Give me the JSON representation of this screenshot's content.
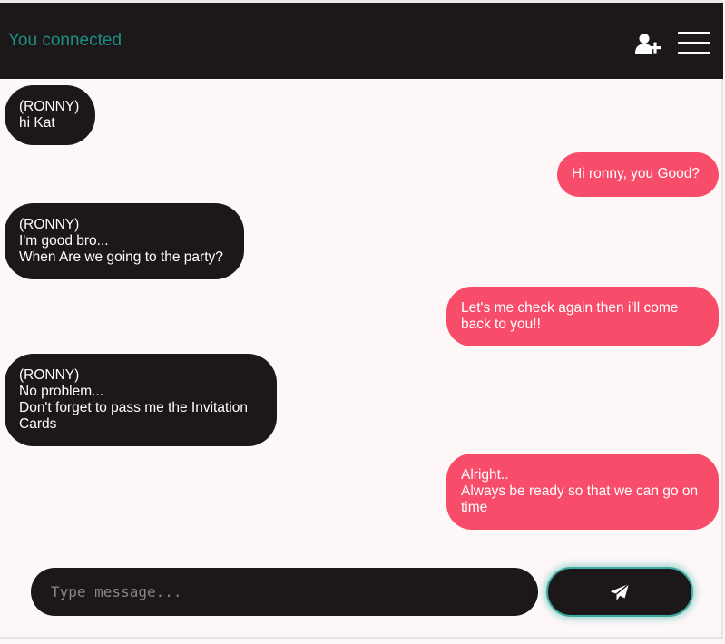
{
  "header": {
    "status": "You connected",
    "add_user_icon": "add-user-icon",
    "menu_icon": "hamburger-menu-icon"
  },
  "messages": [
    {
      "direction": "received",
      "text": "(RONNY)\nhi Kat"
    },
    {
      "direction": "sent",
      "text": "Hi ronny, you Good?"
    },
    {
      "direction": "received",
      "text": "(RONNY)\nI'm good bro...\nWhen Are we going to the party?"
    },
    {
      "direction": "sent",
      "text": "Let's me check again then i'll come back to you!!"
    },
    {
      "direction": "received",
      "text": "(RONNY)\nNo problem...\nDon't forget to pass me the Invitation Cards"
    },
    {
      "direction": "sent",
      "text": "Alright..\nAlways be ready so that we can go on time"
    }
  ],
  "composer": {
    "value": "",
    "placeholder": "Type message...",
    "send_icon": "send-icon"
  },
  "colors": {
    "topbar": "#1c1718",
    "status_text": "#1a8f85",
    "received_bubble": "#1c1718",
    "sent_bubble": "#f74c6a",
    "background": "#fdf7f8",
    "send_glow": "#3ca9a0"
  }
}
